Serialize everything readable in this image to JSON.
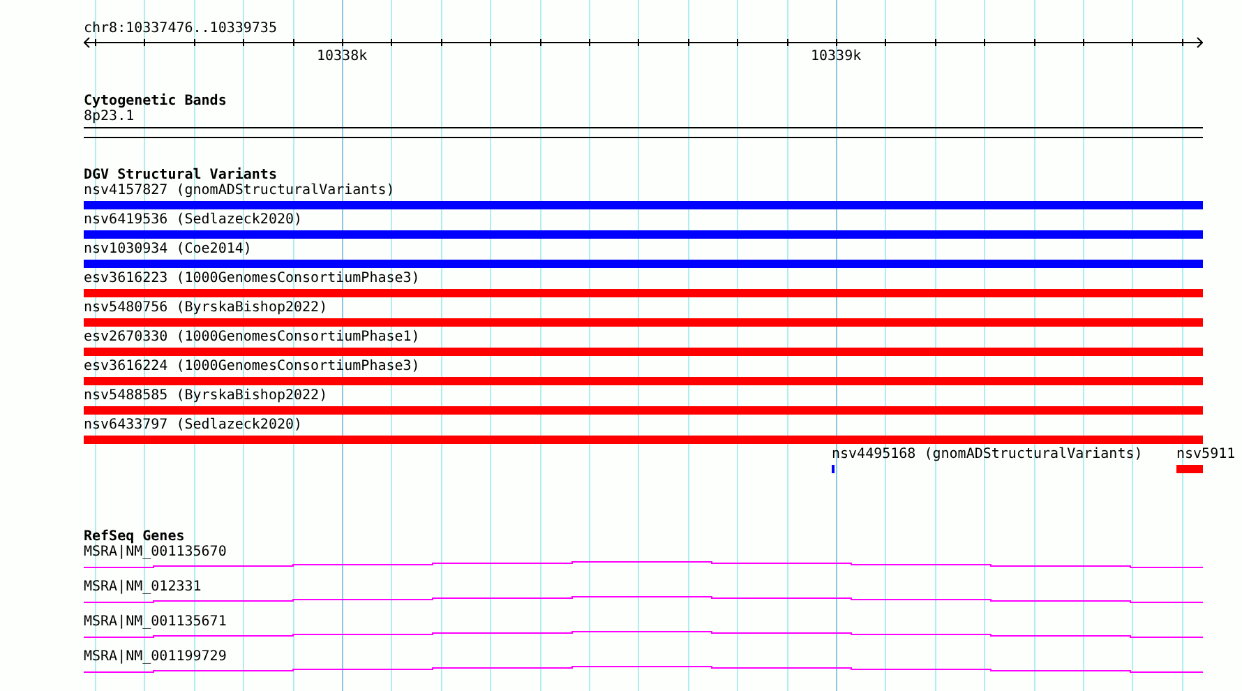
{
  "ruler": {
    "region": "chr8:10337476..10339735",
    "tick_labels": [
      "10338k",
      "10339k"
    ]
  },
  "tracks": [
    {
      "kind": "bands",
      "title": "Cytogenetic Bands",
      "features": [
        {
          "label": "8p23.1"
        }
      ]
    },
    {
      "kind": "variants",
      "title": "DGV Structural Variants",
      "rows": [
        [
          {
            "label": "nsv4157827 (gnomADStructuralVariants)",
            "color": "#0000ff",
            "kind": "full"
          }
        ],
        [
          {
            "label": "nsv6419536 (Sedlazeck2020)",
            "color": "#0000ff",
            "kind": "full"
          }
        ],
        [
          {
            "label": "nsv1030934 (Coe2014)",
            "color": "#0000ff",
            "kind": "full"
          }
        ],
        [
          {
            "label": "esv3616223 (1000GenomesConsortiumPhase3)",
            "color": "#ff0000",
            "kind": "full"
          }
        ],
        [
          {
            "label": "nsv5480756 (ByrskaBishop2022)",
            "color": "#ff0000",
            "kind": "full"
          }
        ],
        [
          {
            "label": "esv2670330 (1000GenomesConsortiumPhase1)",
            "color": "#ff0000",
            "kind": "full"
          }
        ],
        [
          {
            "label": "esv3616224 (1000GenomesConsortiumPhase3)",
            "color": "#ff0000",
            "kind": "full"
          }
        ],
        [
          {
            "label": "nsv5488585 (ByrskaBishop2022)",
            "color": "#ff0000",
            "kind": "full"
          }
        ],
        [
          {
            "label": "nsv6433797 (Sedlazeck2020)",
            "color": "#ff0000",
            "kind": "full"
          }
        ],
        [
          {
            "label": "nsv4495168 (gnomADStructuralVariants)",
            "color": "#0000ff",
            "kind": "point"
          },
          {
            "label": "nsv5911",
            "color": "#ff0000",
            "kind": "clipped"
          }
        ]
      ]
    },
    {
      "kind": "genes",
      "title": "RefSeq Genes",
      "features": [
        {
          "label": "MSRA|NM_001135670"
        },
        {
          "label": "MSRA|NM_012331"
        },
        {
          "label": "MSRA|NM_001135671"
        },
        {
          "label": "MSRA|NM_001199729"
        }
      ]
    }
  ]
}
